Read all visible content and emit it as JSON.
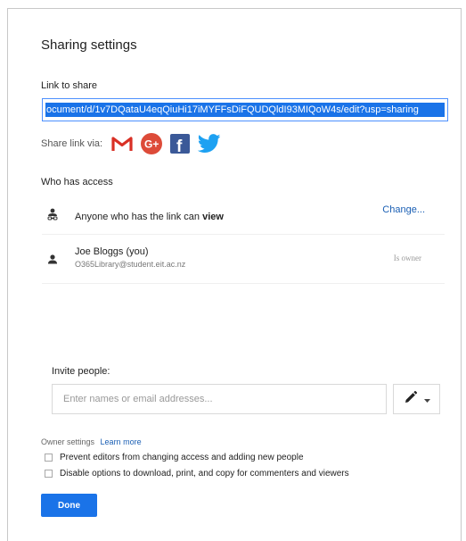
{
  "dialog": {
    "title": "Sharing settings",
    "link_label": "Link to share",
    "link_value": "ocument/d/1v7DQataU4eqQiuHi17iMYFFsDiFQUDQldI93MIQoW4s/edit?usp=sharing",
    "share_via_label": "Share link via:",
    "share_icons": [
      "gmail-icon",
      "google-plus-icon",
      "facebook-icon",
      "twitter-icon"
    ],
    "who_has_access_label": "Who has access",
    "access": {
      "anyone_prefix": "Anyone who has the link can ",
      "anyone_permission": "view",
      "change_label": "Change..."
    },
    "owner": {
      "name": "Joe Bloggs (you)",
      "email": "O365Library@student.eit.ac.nz",
      "role": "Is owner"
    },
    "invite": {
      "label": "Invite people:",
      "placeholder": "Enter names or email addresses..."
    },
    "owner_settings": {
      "label": "Owner settings",
      "learn_more": "Learn more",
      "options": [
        {
          "label": "Prevent editors from changing access and adding new people",
          "checked": false
        },
        {
          "label": "Disable options to download, print, and copy for commenters and viewers",
          "checked": false
        }
      ]
    },
    "done_label": "Done"
  },
  "colors": {
    "accent": "#1a73e8",
    "link": "#1a5fb4",
    "gmail": "#d93025",
    "google_plus": "#dd4b39",
    "facebook": "#3b5998",
    "twitter": "#1da1f2"
  }
}
